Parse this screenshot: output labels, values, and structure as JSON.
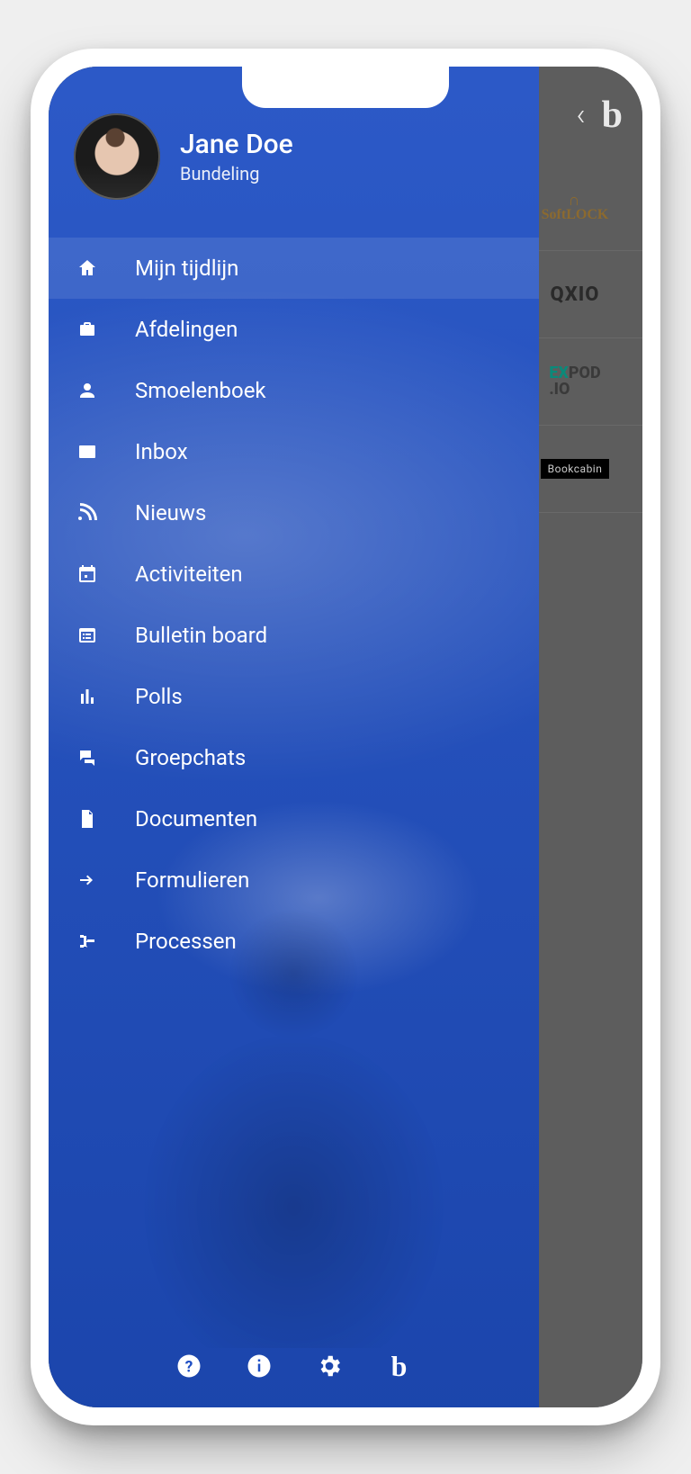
{
  "colors": {
    "drawer": "#1f4fc4",
    "selected": "rgba(255,255,255,.10)"
  },
  "topbar": {
    "back_glyph": "‹",
    "logo_glyph": "b"
  },
  "under_items": [
    {
      "id": "softlock",
      "label": "SoftLOCK",
      "kind": "text-logo"
    },
    {
      "id": "qxio",
      "label": "QXIO",
      "kind": "text-logo"
    },
    {
      "id": "expod",
      "label": "EXPOD .IO",
      "kind": "text-logo"
    },
    {
      "id": "bookcabin",
      "label": "Bookcabin",
      "kind": "badge"
    }
  ],
  "profile": {
    "name": "Jane Doe",
    "org": "Bundeling"
  },
  "nav": [
    {
      "id": "timeline",
      "icon": "home-icon",
      "label": "Mijn tijdlijn",
      "selected": true
    },
    {
      "id": "departments",
      "icon": "briefcase-icon",
      "label": "Afdelingen"
    },
    {
      "id": "people",
      "icon": "person-icon",
      "label": "Smoelenboek"
    },
    {
      "id": "inbox",
      "icon": "mail-icon",
      "label": "Inbox"
    },
    {
      "id": "news",
      "icon": "rss-icon",
      "label": "Nieuws"
    },
    {
      "id": "activities",
      "icon": "calendar-icon",
      "label": "Activiteiten"
    },
    {
      "id": "bulletin",
      "icon": "board-icon",
      "label": "Bulletin board"
    },
    {
      "id": "polls",
      "icon": "poll-icon",
      "label": "Polls"
    },
    {
      "id": "groupchats",
      "icon": "chat-icon",
      "label": "Groepchats"
    },
    {
      "id": "documents",
      "icon": "file-icon",
      "label": "Documenten"
    },
    {
      "id": "forms",
      "icon": "arrow-right-icon",
      "label": "Formulieren"
    },
    {
      "id": "processes",
      "icon": "tree-icon",
      "label": "Processen"
    }
  ],
  "bottom": [
    {
      "id": "help",
      "icon": "help-icon"
    },
    {
      "id": "info",
      "icon": "info-icon"
    },
    {
      "id": "settings",
      "icon": "gear-icon"
    },
    {
      "id": "brand",
      "icon": "brand-icon",
      "glyph": "b"
    }
  ]
}
